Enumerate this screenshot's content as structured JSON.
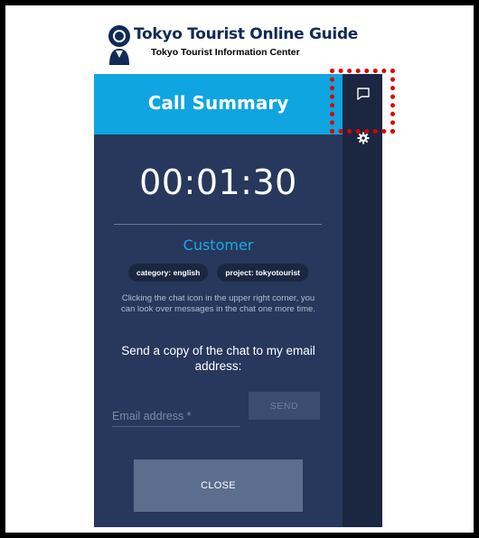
{
  "brand": {
    "title": "Tokyo Tourist Online Guide",
    "subtitle": "Tokyo Tourist Information Center",
    "logo_icon": "guide-person-logo-icon"
  },
  "panel": {
    "title": "Call Summary",
    "timer": "00:01:30",
    "customer_label": "Customer",
    "tags": [
      "category: english",
      "project: tokyotourist"
    ],
    "info_text": "Clicking the chat icon in the upper right corner, you can look over messages in the chat one more time.",
    "send_copy_text": "Send a copy of the chat to my email address:",
    "email_placeholder": "Email address *",
    "send_label": "SEND",
    "close_label": "CLOSE"
  },
  "rail": {
    "icons": [
      "chat-icon",
      "gear-icon"
    ]
  },
  "colors": {
    "header_blue": "#0ea5e0",
    "panel_bg": "#27385c",
    "rail_bg": "#1b2740",
    "highlight_red": "#e00000",
    "customer_blue": "#1aa8e6"
  }
}
